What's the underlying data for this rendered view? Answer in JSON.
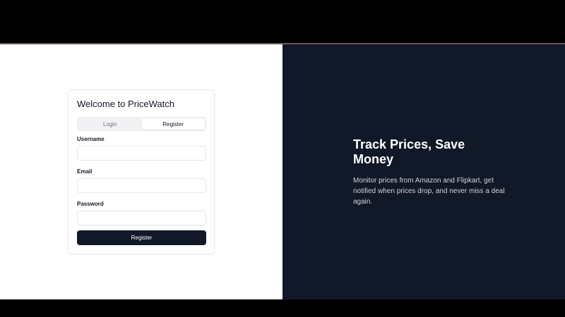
{
  "auth_card": {
    "title": "Welcome to PriceWatch",
    "tabs": [
      {
        "label": "Login",
        "active": false
      },
      {
        "label": "Register",
        "active": true
      }
    ],
    "fields": {
      "username": {
        "label": "Username",
        "value": "",
        "placeholder": ""
      },
      "email": {
        "label": "Email",
        "value": "",
        "placeholder": ""
      },
      "password": {
        "label": "Password",
        "value": "",
        "placeholder": ""
      }
    },
    "submit_label": "Register"
  },
  "hero": {
    "title": "Track Prices, Save Money",
    "description": "Monitor prices from Amazon and Flipkart, get notified when prices drop, and never miss a deal again."
  },
  "colors": {
    "dark_navy": "#111827",
    "card_border": "#e5e7eb",
    "tab_bg": "#f1f1f3"
  }
}
